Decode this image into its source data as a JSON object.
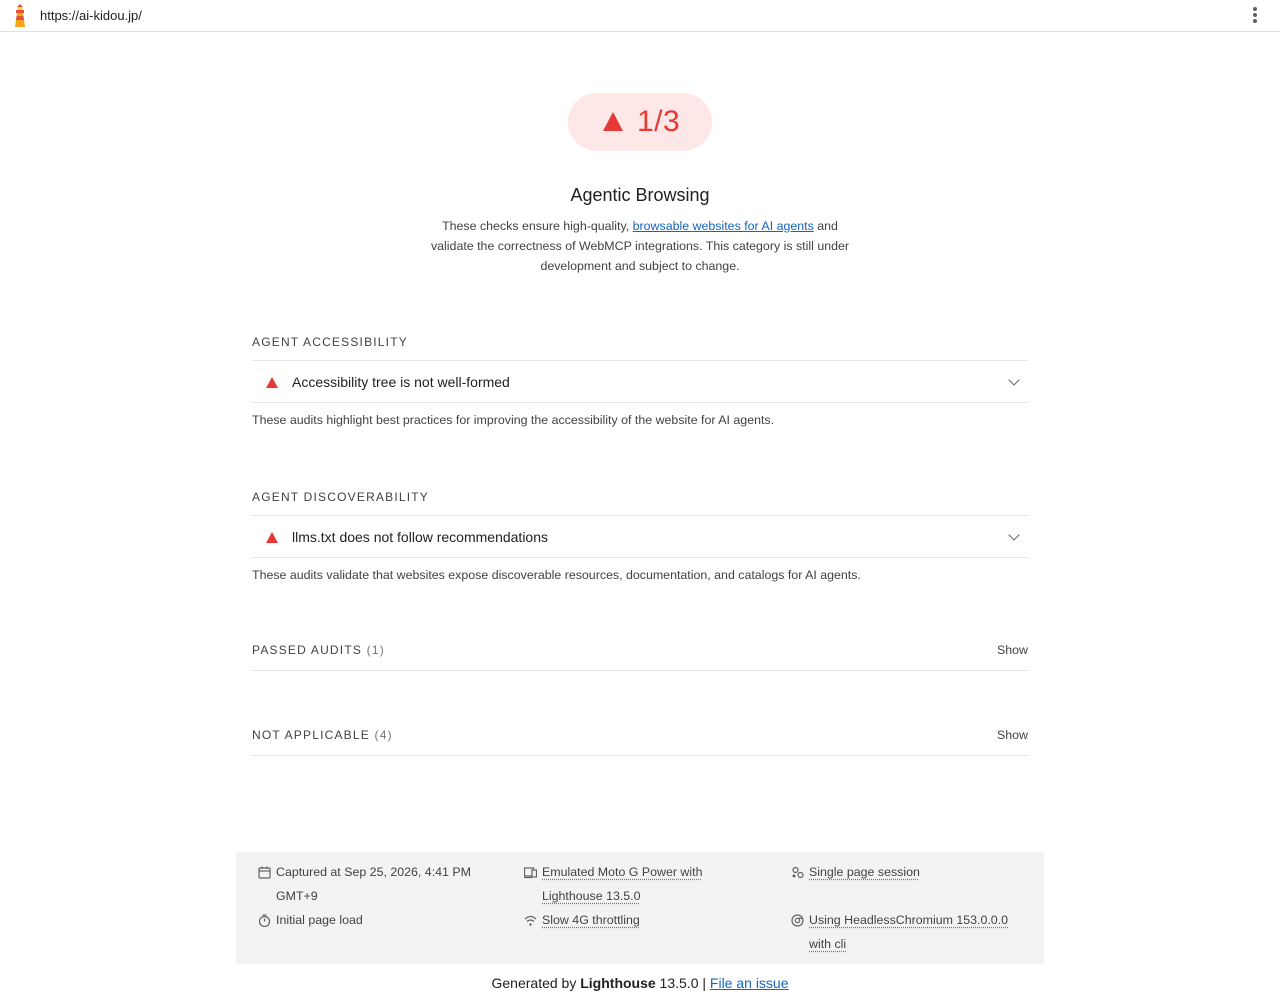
{
  "topbar": {
    "url": "https://ai-kidou.jp/"
  },
  "score": {
    "value": "1/3"
  },
  "category": {
    "title": "Agentic Browsing",
    "desc_prefix": "These checks ensure high-quality, ",
    "desc_link": "browsable websites for AI agents",
    "desc_suffix": " and validate the correctness of WebMCP integrations. This category is still under development and subject to change."
  },
  "groups": [
    {
      "heading": "AGENT ACCESSIBILITY",
      "audit_title": "Accessibility tree is not well-formed",
      "description": "These audits highlight best practices for improving the accessibility of the website for AI agents."
    },
    {
      "heading": "AGENT DISCOVERABILITY",
      "audit_title": "llms.txt does not follow recommendations",
      "description": "These audits validate that websites expose discoverable resources, documentation, and catalogs for AI agents."
    }
  ],
  "passed": {
    "label": "PASSED AUDITS",
    "count": "(1)",
    "show": "Show"
  },
  "not_applicable": {
    "label": "NOT APPLICABLE",
    "count": "(4)",
    "show": "Show"
  },
  "info": {
    "captured": "Captured at Sep 25, 2026, 4:41 PM GMT+9",
    "initial_load": "Initial page load",
    "emulated": "Emulated Moto G Power with Lighthouse 13.5.0",
    "throttling": "Slow 4G throttling",
    "session": "Single page session",
    "browser": "Using HeadlessChromium 153.0.0.0 with cli"
  },
  "footer": {
    "generated_prefix": "Generated by ",
    "brand": "Lighthouse",
    "version": " 13.5.0 | ",
    "issue_link": "File an issue"
  },
  "colors": {
    "fail": "#e53935",
    "link": "#1565c0",
    "badge_bg": "#fde7e7"
  }
}
